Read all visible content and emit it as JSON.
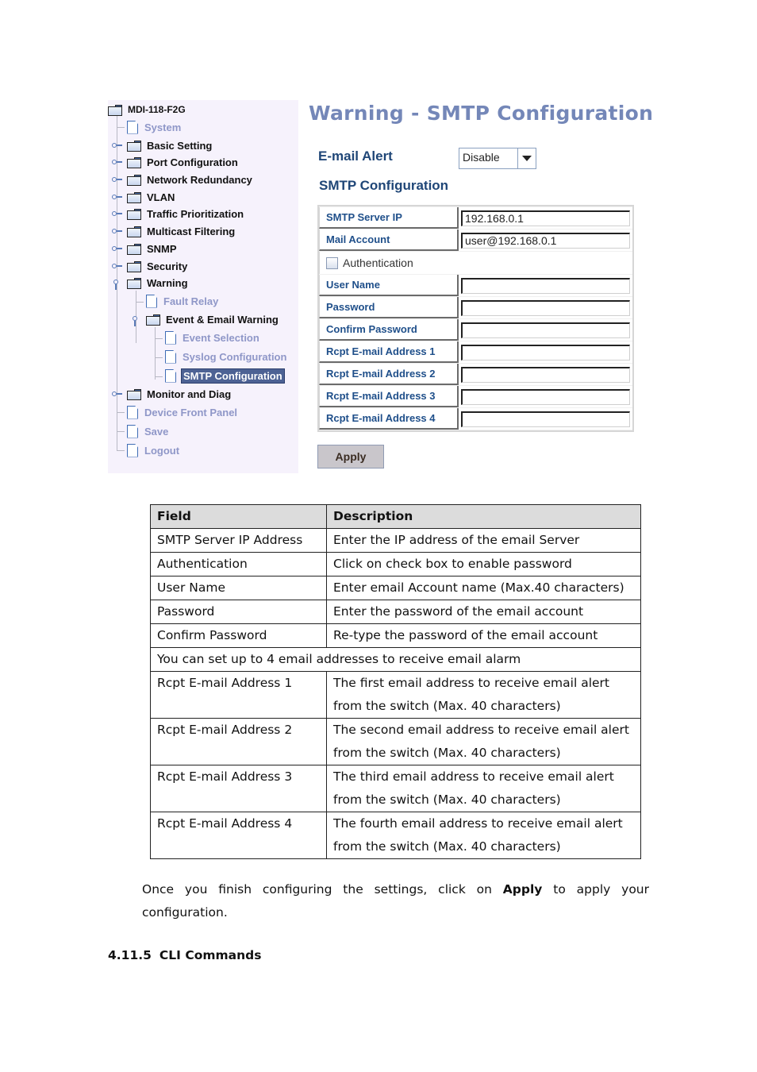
{
  "tree": {
    "root": "MDI-118-F2G",
    "items": [
      {
        "label": "System",
        "type": "page"
      },
      {
        "label": "Basic Setting",
        "type": "folder"
      },
      {
        "label": "Port Configuration",
        "type": "folder"
      },
      {
        "label": "Network Redundancy",
        "type": "folder"
      },
      {
        "label": "VLAN",
        "type": "folder"
      },
      {
        "label": "Traffic Prioritization",
        "type": "folder"
      },
      {
        "label": "Multicast Filtering",
        "type": "folder"
      },
      {
        "label": "SNMP",
        "type": "folder"
      },
      {
        "label": "Security",
        "type": "folder"
      },
      {
        "label": "Warning",
        "type": "folder",
        "expanded": true
      },
      {
        "label": "Fault Relay",
        "type": "page"
      },
      {
        "label": "Event & Email Warning",
        "type": "folder",
        "expanded": true
      },
      {
        "label": "Event Selection",
        "type": "page"
      },
      {
        "label": "Syslog Configuration",
        "type": "page"
      },
      {
        "label": "SMTP Configuration",
        "type": "page",
        "selected": true
      },
      {
        "label": "Monitor and Diag",
        "type": "folder"
      },
      {
        "label": "Device Front Panel",
        "type": "page"
      },
      {
        "label": "Save",
        "type": "page"
      },
      {
        "label": "Logout",
        "type": "page"
      }
    ]
  },
  "page": {
    "title": "Warning - SMTP Configuration",
    "email_alert_label": "E-mail Alert",
    "email_alert_value": "Disable",
    "smtp_heading": "SMTP Configuration",
    "fields": {
      "smtp_server_ip": {
        "label": "SMTP Server IP",
        "value": "192.168.0.1"
      },
      "mail_account": {
        "label": "Mail Account",
        "value": "user@192.168.0.1"
      },
      "authentication": {
        "label": "Authentication",
        "checked": false
      },
      "user_name": {
        "label": "User Name",
        "value": ""
      },
      "password": {
        "label": "Password",
        "value": ""
      },
      "confirm_password": {
        "label": "Confirm Password",
        "value": ""
      },
      "rcpt1": {
        "label": "Rcpt E-mail Address 1",
        "value": ""
      },
      "rcpt2": {
        "label": "Rcpt E-mail Address 2",
        "value": ""
      },
      "rcpt3": {
        "label": "Rcpt E-mail Address 3",
        "value": ""
      },
      "rcpt4": {
        "label": "Rcpt E-mail Address 4",
        "value": ""
      }
    },
    "apply_label": "Apply"
  },
  "doc_table": {
    "headers": [
      "Field",
      "Description"
    ],
    "rows": [
      [
        "SMTP Server IP Address",
        "Enter the IP address of the email Server"
      ],
      [
        "Authentication",
        "Click on check box to enable password"
      ],
      [
        "User Name",
        "Enter email Account name (Max.40 characters)"
      ],
      [
        "Password",
        "Enter the password of the email account"
      ],
      [
        "Confirm Password",
        "Re-type the password of the email account"
      ]
    ],
    "span_note": "You can set up to 4 email addresses to receive email alarm",
    "rcpt_rows": [
      [
        "Rcpt E-mail Address 1",
        "The first email address to receive email alert",
        "from the switch (Max. 40 characters)"
      ],
      [
        "Rcpt E-mail Address 2",
        "The second email address to receive email alert",
        "from the switch (Max. 40 characters)"
      ],
      [
        "Rcpt E-mail Address 3",
        "The third email address to receive email alert",
        "from the switch (Max. 40 characters)"
      ],
      [
        "Rcpt E-mail Address 4",
        "The fourth email address to receive email alert",
        "from the switch (Max. 40 characters)"
      ]
    ]
  },
  "paragraph": {
    "before": "Once you finish configuring the settings, click on ",
    "bold": "Apply",
    "after": " to apply your configuration."
  },
  "section": {
    "number": "4.11.5",
    "title": "CLI Commands"
  }
}
